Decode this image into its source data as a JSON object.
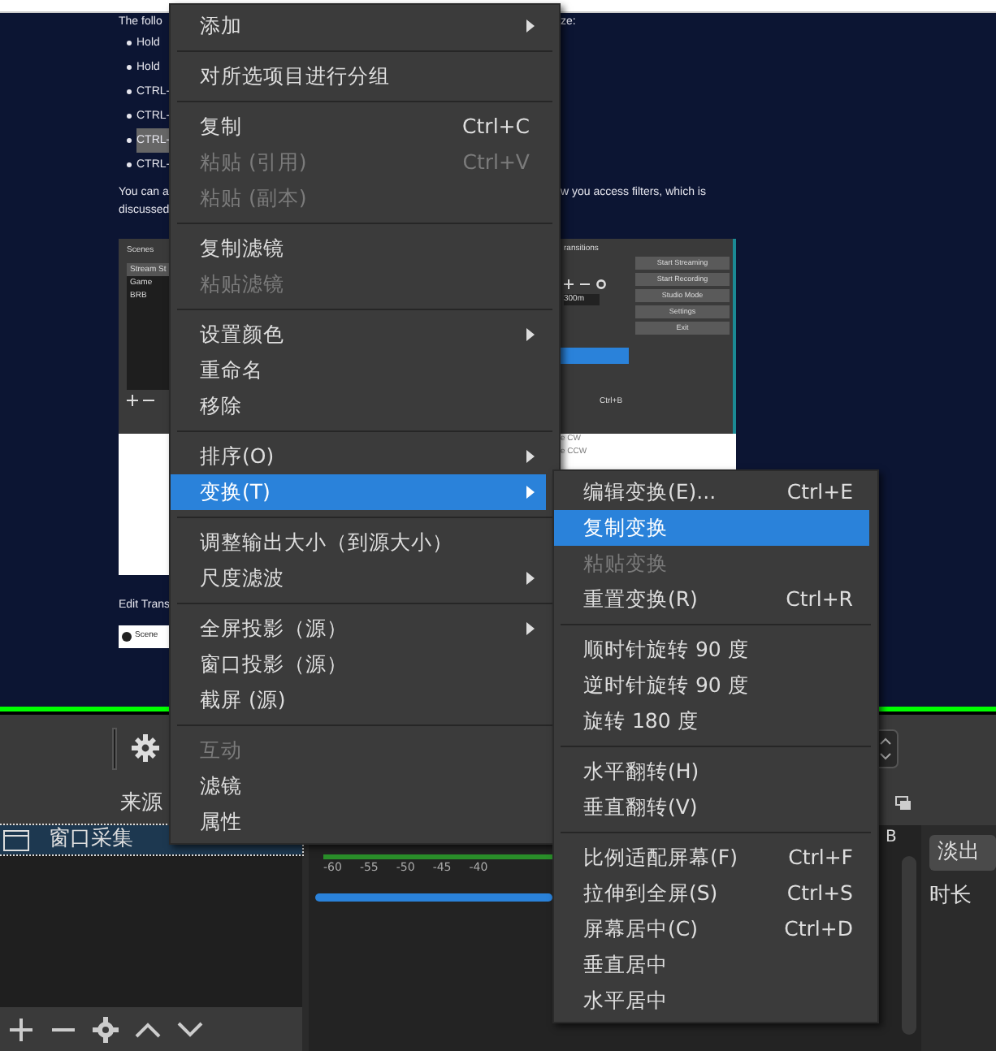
{
  "article": {
    "intro": "The follo",
    "intro_end": "ze:",
    "bullets": [
      {
        "text": "Hold",
        "highlighted": false
      },
      {
        "text": "Hold",
        "highlighted": false
      },
      {
        "text": "CTRL-",
        "highlighted": false
      },
      {
        "text": "CTRL-",
        "highlighted": false
      },
      {
        "text": "CTRL-",
        "highlighted": true
      },
      {
        "text": "CTRL-",
        "highlighted": false
      }
    ],
    "paragraph_start": "You can a",
    "paragraph_end": "w you access filters, which is",
    "paragraph_line2": "discussed",
    "figure": {
      "scenes_title": "Scenes",
      "scenes": [
        {
          "name": "Stream St",
          "selected": true
        },
        {
          "name": "Game",
          "selected": false
        },
        {
          "name": "BRB",
          "selected": false
        }
      ],
      "transitions_title": "ransitions",
      "duration": "300m",
      "controls": [
        "Start Streaming",
        "Start Recording",
        "Studio Mode",
        "Settings",
        "Exit"
      ],
      "hotkey": "Ctrl+B",
      "rotate_items": [
        "e CW",
        "e CCW"
      ]
    },
    "caption": "Edit Trans",
    "figure2_label": "Scene"
  },
  "obs": {
    "sources_header": "来源",
    "sources": [
      {
        "name": "窗口采集",
        "selected": true
      }
    ],
    "meter_ticks": [
      "-60",
      "-55",
      "-50",
      "-45",
      "-40"
    ],
    "mixer_unit": "B",
    "transition": "淡出",
    "duration_label": "时长"
  },
  "context_menu": {
    "items": [
      {
        "kind": "item",
        "label": "添加",
        "submenu": true,
        "disabled": false,
        "selected": false
      },
      {
        "kind": "separator"
      },
      {
        "kind": "item",
        "label": "对所选项目进行分组",
        "submenu": false,
        "disabled": false,
        "selected": false
      },
      {
        "kind": "separator"
      },
      {
        "kind": "item",
        "label": "复制",
        "shortcut": "Ctrl+C",
        "submenu": false,
        "disabled": false,
        "selected": false
      },
      {
        "kind": "item",
        "label": "粘贴 (引用)",
        "shortcut": "Ctrl+V",
        "submenu": false,
        "disabled": true,
        "selected": false
      },
      {
        "kind": "item",
        "label": "粘贴 (副本)",
        "submenu": false,
        "disabled": true,
        "selected": false
      },
      {
        "kind": "separator"
      },
      {
        "kind": "item",
        "label": "复制滤镜",
        "submenu": false,
        "disabled": false,
        "selected": false
      },
      {
        "kind": "item",
        "label": "粘贴滤镜",
        "submenu": false,
        "disabled": true,
        "selected": false
      },
      {
        "kind": "separator"
      },
      {
        "kind": "item",
        "label": "设置颜色",
        "submenu": true,
        "disabled": false,
        "selected": false
      },
      {
        "kind": "item",
        "label": "重命名",
        "submenu": false,
        "disabled": false,
        "selected": false
      },
      {
        "kind": "item",
        "label": "移除",
        "submenu": false,
        "disabled": false,
        "selected": false
      },
      {
        "kind": "separator"
      },
      {
        "kind": "item",
        "label": "排序(O)",
        "submenu": true,
        "disabled": false,
        "selected": false
      },
      {
        "kind": "item",
        "label": "变换(T)",
        "submenu": true,
        "disabled": false,
        "selected": true
      },
      {
        "kind": "separator"
      },
      {
        "kind": "item",
        "label": "调整输出大小（到源大小）",
        "submenu": false,
        "disabled": false,
        "selected": false
      },
      {
        "kind": "item",
        "label": "尺度滤波",
        "submenu": true,
        "disabled": false,
        "selected": false
      },
      {
        "kind": "separator"
      },
      {
        "kind": "item",
        "label": "全屏投影（源）",
        "submenu": true,
        "disabled": false,
        "selected": false
      },
      {
        "kind": "item",
        "label": "窗口投影（源）",
        "submenu": false,
        "disabled": false,
        "selected": false
      },
      {
        "kind": "item",
        "label": "截屏 (源)",
        "submenu": false,
        "disabled": false,
        "selected": false
      },
      {
        "kind": "separator"
      },
      {
        "kind": "item",
        "label": "互动",
        "submenu": false,
        "disabled": true,
        "selected": false
      },
      {
        "kind": "item",
        "label": "滤镜",
        "submenu": false,
        "disabled": false,
        "selected": false
      },
      {
        "kind": "item",
        "label": "属性",
        "submenu": false,
        "disabled": false,
        "selected": false
      }
    ]
  },
  "transform_submenu": {
    "items": [
      {
        "kind": "item",
        "label": "编辑变换(E)...",
        "shortcut": "Ctrl+E",
        "submenu": false,
        "disabled": false,
        "selected": false
      },
      {
        "kind": "item",
        "label": "复制变换",
        "submenu": false,
        "disabled": false,
        "selected": true
      },
      {
        "kind": "item",
        "label": "粘贴变换",
        "submenu": false,
        "disabled": true,
        "selected": false
      },
      {
        "kind": "item",
        "label": "重置变换(R)",
        "shortcut": "Ctrl+R",
        "submenu": false,
        "disabled": false,
        "selected": false
      },
      {
        "kind": "separator"
      },
      {
        "kind": "item",
        "label": "顺时针旋转 90 度",
        "submenu": false,
        "disabled": false,
        "selected": false
      },
      {
        "kind": "item",
        "label": "逆时针旋转 90 度",
        "submenu": false,
        "disabled": false,
        "selected": false
      },
      {
        "kind": "item",
        "label": "旋转 180 度",
        "submenu": false,
        "disabled": false,
        "selected": false
      },
      {
        "kind": "separator"
      },
      {
        "kind": "item",
        "label": "水平翻转(H)",
        "submenu": false,
        "disabled": false,
        "selected": false
      },
      {
        "kind": "item",
        "label": "垂直翻转(V)",
        "submenu": false,
        "disabled": false,
        "selected": false
      },
      {
        "kind": "separator"
      },
      {
        "kind": "item",
        "label": "比例适配屏幕(F)",
        "shortcut": "Ctrl+F",
        "submenu": false,
        "disabled": false,
        "selected": false
      },
      {
        "kind": "item",
        "label": "拉伸到全屏(S)",
        "shortcut": "Ctrl+S",
        "submenu": false,
        "disabled": false,
        "selected": false
      },
      {
        "kind": "item",
        "label": "屏幕居中(C)",
        "shortcut": "Ctrl+D",
        "submenu": false,
        "disabled": false,
        "selected": false
      },
      {
        "kind": "item",
        "label": "垂直居中",
        "submenu": false,
        "disabled": false,
        "selected": false
      },
      {
        "kind": "item",
        "label": "水平居中",
        "submenu": false,
        "disabled": false,
        "selected": false
      }
    ]
  }
}
